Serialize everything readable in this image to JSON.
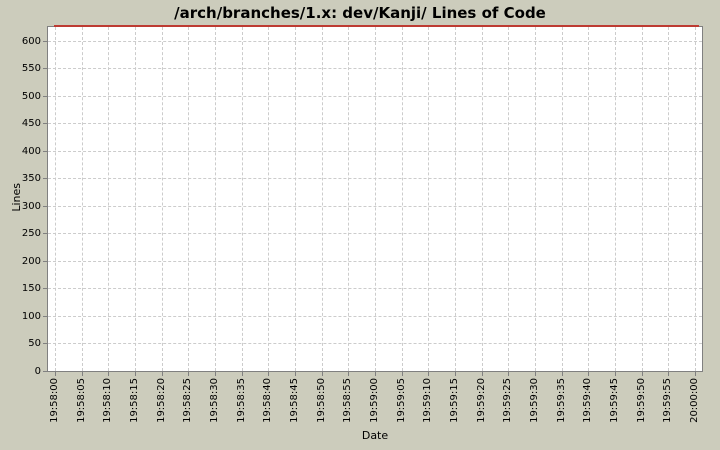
{
  "window": {
    "background_color": "#CCCCBC"
  },
  "chart_data": {
    "type": "line",
    "title": "/arch/branches/1.x: dev/Kanji/ Lines of Code",
    "xlabel": "Date",
    "ylabel": "Lines",
    "x_tick_labels": [
      "19:58:00",
      "19:58:05",
      "19:58:10",
      "19:58:15",
      "19:58:20",
      "19:58:25",
      "19:58:30",
      "19:58:35",
      "19:58:40",
      "19:58:45",
      "19:58:50",
      "19:58:55",
      "19:59:00",
      "19:59:05",
      "19:59:10",
      "19:59:15",
      "19:59:20",
      "19:59:25",
      "19:59:30",
      "19:59:35",
      "19:59:40",
      "19:59:45",
      "19:59:50",
      "19:59:55",
      "20:00:00"
    ],
    "y_tick_labels": [
      0,
      50,
      100,
      150,
      200,
      250,
      300,
      350,
      400,
      450,
      500,
      550,
      600
    ],
    "ylim": [
      0,
      625
    ],
    "grid": true,
    "grid_style": "dashed",
    "legend_position": "none",
    "series": [
      {
        "name": "Lines of Code",
        "color": "#BD3B32",
        "x": [
          "19:58:02",
          "19:59:58"
        ],
        "values": [
          625,
          625
        ]
      }
    ],
    "colors": {
      "plot_background": "#FFFFFF",
      "grid_color": "#CCCCCC",
      "axis_outline": "#808080",
      "tick_label_color": "#000000",
      "title_color": "#000000"
    }
  }
}
